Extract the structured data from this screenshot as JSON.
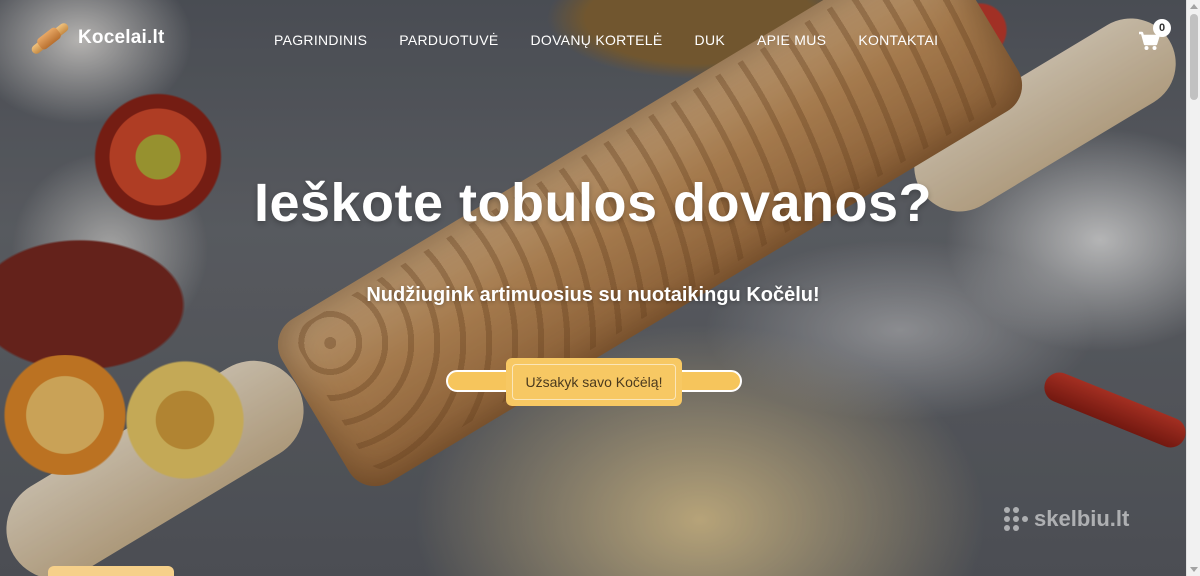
{
  "brand": {
    "name": "Kocelai.lt",
    "logo_icon": "rolling-pin-icon",
    "accent": "#f7c863"
  },
  "nav": {
    "items": [
      {
        "label": "PAGRINDINIS"
      },
      {
        "label": "PARDUOTUVĖ"
      },
      {
        "label": "DOVANŲ KORTELĖ"
      },
      {
        "label": "DUK"
      },
      {
        "label": "APIE MUS"
      },
      {
        "label": "KONTAKTAI"
      }
    ]
  },
  "cart": {
    "icon": "cart-icon",
    "count": "0"
  },
  "hero": {
    "headline": "Ieškote tobulos dovanos?",
    "subline": "Nudžiugink artimuosius su nuotaikingu Kočėlu!",
    "cta_label": "Užsakyk savo Kočėlą!"
  },
  "watermark": {
    "text": "skelbiu.lt"
  }
}
